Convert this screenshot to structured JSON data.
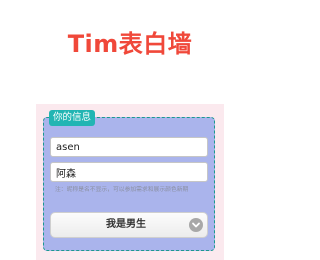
{
  "title": "Tim表白墙",
  "info_panel": {
    "legend": "你的信息",
    "name_input": {
      "value": "asen"
    },
    "target_input": {
      "value": "阿森"
    },
    "hint": "注：昵称是名不显示，可以参加需求和展示颜色新期",
    "gender_select": {
      "selected": "我是男生"
    }
  },
  "colors": {
    "title": "#f0483a",
    "panel_bg": "#aab4ec",
    "panel_border": "#1a9a8e",
    "legend_bg": "#22b5b3",
    "page_bg": "#fbe9ee"
  }
}
